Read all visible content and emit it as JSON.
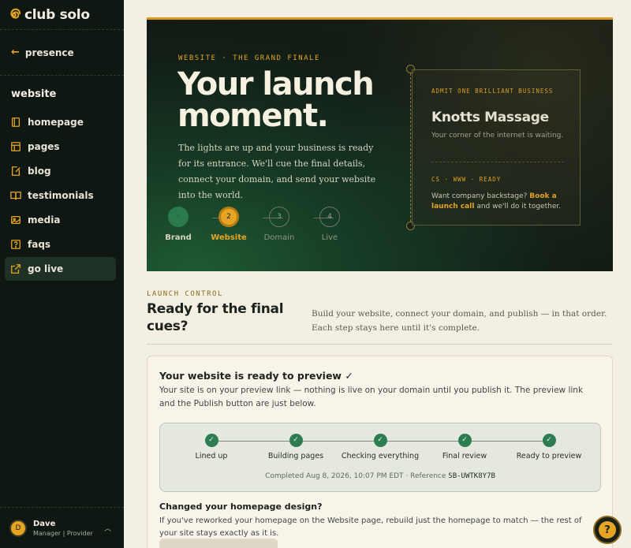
{
  "brand": {
    "name": "club solo",
    "accent": "#e5a523"
  },
  "sidebar": {
    "back_label": "presence",
    "section_title": "website",
    "items": [
      {
        "label": "homepage",
        "icon": "book-icon"
      },
      {
        "label": "pages",
        "icon": "layout-icon"
      },
      {
        "label": "blog",
        "icon": "edit-note-icon"
      },
      {
        "label": "testimonials",
        "icon": "open-book-icon"
      },
      {
        "label": "media",
        "icon": "image-icon"
      },
      {
        "label": "faqs",
        "icon": "help-square-icon"
      },
      {
        "label": "go live",
        "icon": "external-link-icon",
        "active": true
      }
    ],
    "user": {
      "initial": "D",
      "name": "Dave",
      "role": "Manager | Provider"
    }
  },
  "hero": {
    "eyebrow": "WEBSITE · THE GRAND FINALE",
    "title": "Your launch moment.",
    "body": "The lights are up and your business is ready for its entrance. We'll cue the final details, connect your domain, and send your website into the world.",
    "steps": [
      {
        "number": "·",
        "label": "Brand",
        "state": "done"
      },
      {
        "number": "2",
        "label": "Website",
        "state": "current"
      },
      {
        "number": "3",
        "label": "Domain",
        "state": "todo"
      },
      {
        "number": "4",
        "label": "Live",
        "state": "todo"
      }
    ],
    "ticket": {
      "kicker": "ADMIT ONE BRILLIANT BUSINESS",
      "business_name": "Knotts Massage",
      "tagline": "Your corner of the internet is waiting.",
      "kicker2": "CS · WWW · READY",
      "cta_before": "Want company backstage?",
      "cta_link": "Book a launch call",
      "cta_after": "and we'll do it together."
    }
  },
  "launch_control": {
    "eyebrow": "LAUNCH CONTROL",
    "title": "Ready for the final cues?",
    "description": "Build your website, connect your domain, and publish — in that order. Each step stays here until it's complete."
  },
  "preview_card": {
    "title": "Your website is ready to preview ✓",
    "body": "Your site is on your preview link — nothing is live on your domain until you publish it. The preview link and the Publish button are just below.",
    "progress_steps": [
      {
        "label": "Lined up",
        "check": "✓"
      },
      {
        "label": "Building pages",
        "check": "✓"
      },
      {
        "label": "Checking everything",
        "check": "✓"
      },
      {
        "label": "Final review",
        "check": "✓"
      },
      {
        "label": "Ready to preview",
        "check": "✓"
      }
    ],
    "completed_text": "Completed Aug 8, 2026, 10:07 PM EDT · Reference",
    "reference": "SB-UWTK8Y7B",
    "redesign_title": "Changed your homepage design?",
    "redesign_body": "If you've reworked your homepage on the Website page, rebuild just the homepage to match — the rest of your site stays exactly as it is."
  },
  "help_button": {
    "label": "?"
  }
}
